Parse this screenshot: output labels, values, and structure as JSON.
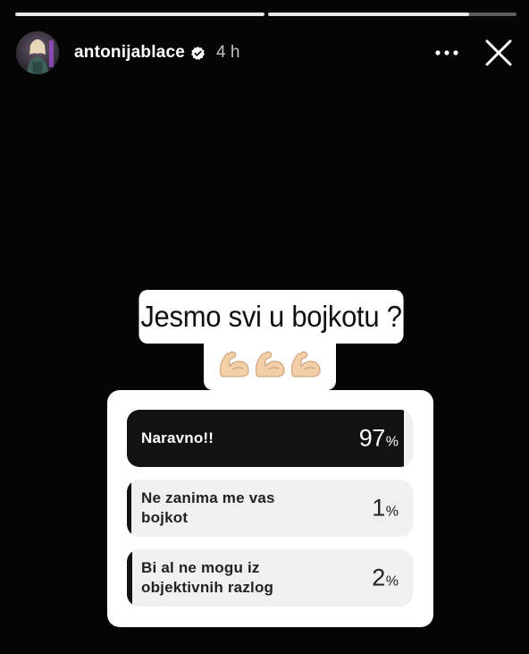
{
  "progress": {
    "segments": [
      {
        "fill": 1.0
      },
      {
        "fill": 0.81
      }
    ]
  },
  "header": {
    "username": "antonijablace",
    "verified": true,
    "timestamp": "4 h",
    "more_icon": "more-horizontal-icon",
    "close_icon": "close-icon"
  },
  "story": {
    "question": "Jesmo svi u bojkotu ?",
    "emoji": [
      "flexed-biceps",
      "flexed-biceps",
      "flexed-biceps"
    ]
  },
  "poll": {
    "options": [
      {
        "label": "Naravno!!",
        "percent": "97",
        "sign": "%",
        "fraction": 0.97
      },
      {
        "label": "Ne zanima me vas bojkot",
        "percent": "1",
        "sign": "%",
        "fraction": 0.01
      },
      {
        "label": "Bi al ne mogu iz objektivnih razlog",
        "percent": "2",
        "sign": "%",
        "fraction": 0.02
      }
    ]
  },
  "colors": {
    "background": "#050505",
    "poll_fill": "#121212",
    "poll_track": "#f0f0f0",
    "verified_badge": "#ffffff"
  }
}
